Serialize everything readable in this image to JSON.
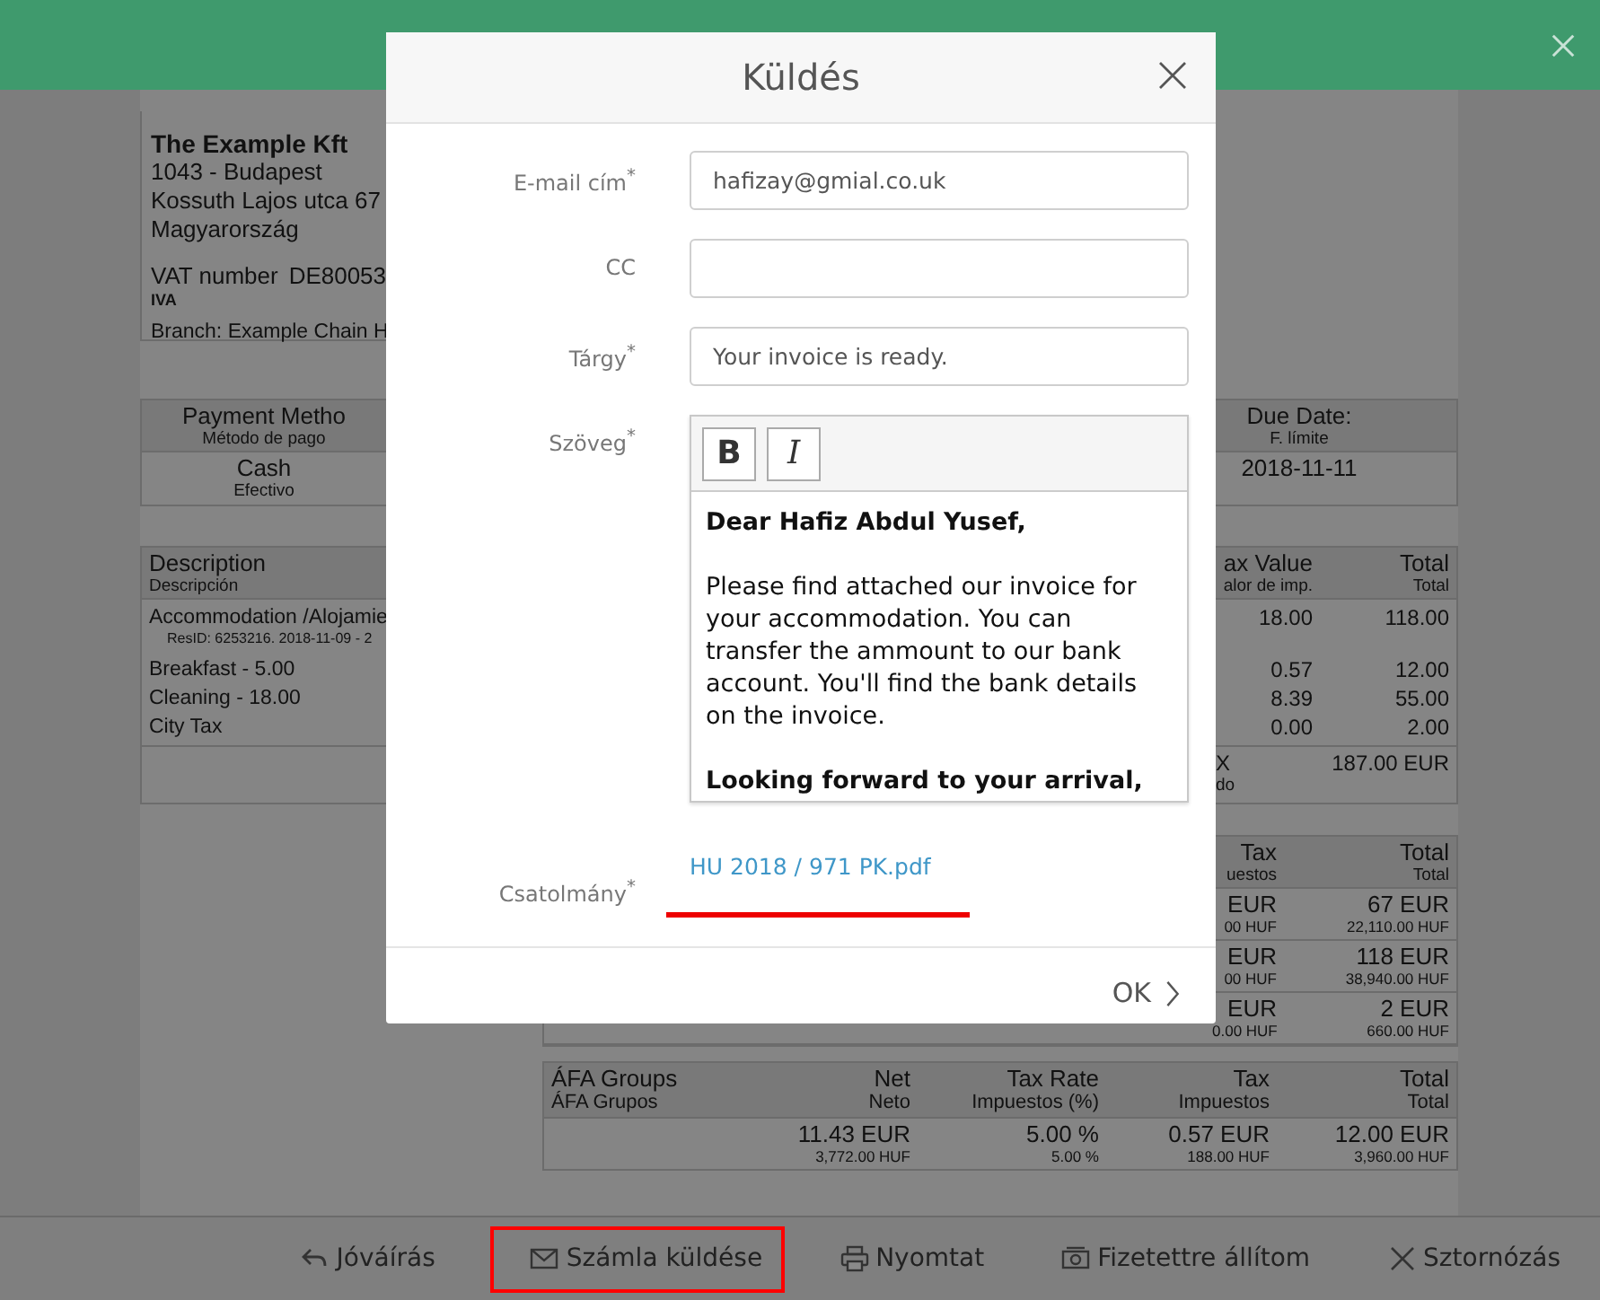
{
  "invoice": {
    "company": {
      "name": "The Example Kft",
      "lines": [
        "1043 - Budapest",
        "Kossuth Lajos utca 67",
        "Magyarország"
      ],
      "vat_label": "VAT number",
      "vat_value": "DE80053",
      "vat_sub": "IVA",
      "branch": "Branch: Example Chain H"
    },
    "payment": {
      "header": "Payment Metho",
      "sub": "Método de pago",
      "value": "Cash",
      "value_sub": "Efectivo"
    },
    "due": {
      "header": "Due Date:",
      "sub": "F. límite",
      "value": "2018-11-11"
    },
    "items": {
      "columns": [
        {
          "title": "Description",
          "sub": "Descripción"
        },
        {
          "title": "ax Value",
          "sub": "alor de imp."
        },
        {
          "title": "Total",
          "sub": "Total"
        }
      ],
      "rows": [
        {
          "description": "Accommodation /Alojamie",
          "note": "ResID: 6253216. 2018-11-09 - 2",
          "tax_value": "18.00",
          "total": "118.00"
        },
        {
          "description": "Breakfast - 5.00",
          "tax_value": "0.57",
          "total": "12.00"
        },
        {
          "description": "Cleaning - 18.00",
          "tax_value": "8.39",
          "total": "55.00"
        },
        {
          "description": "City Tax",
          "tax_value": "0.00",
          "total": "2.00"
        }
      ],
      "total_label": "X",
      "total_sub": "do",
      "total_value": "187.00 EUR"
    },
    "tax_summary": {
      "columns": [
        {
          "title": "Tax",
          "sub": "uestos"
        },
        {
          "title": "Total",
          "sub": "Total"
        }
      ],
      "rows": [
        {
          "tax": "EUR",
          "tax_sub": "00 HUF",
          "total": "67 EUR",
          "total_sub": "22,110.00 HUF"
        },
        {
          "tax": "EUR",
          "tax_sub": "00 HUF",
          "total": "118 EUR",
          "total_sub": "38,940.00 HUF"
        },
        {
          "tax": "EUR",
          "tax_sub": "0.00 HUF",
          "total": "2 EUR",
          "total_sub": "660.00 HUF"
        }
      ]
    },
    "vat_groups": {
      "columns": [
        {
          "title": "ÁFA Groups",
          "sub": "ÁFA Grupos"
        },
        {
          "title": "Net",
          "sub": "Neto"
        },
        {
          "title": "Tax Rate",
          "sub": "Impuestos (%)"
        },
        {
          "title": "Tax",
          "sub": "Impuestos"
        },
        {
          "title": "Total",
          "sub": "Total"
        }
      ],
      "rows": [
        {
          "net": "11.43 EUR",
          "net_huf": "3,772.00 HUF",
          "tax_rate": "5.00 %",
          "tax_rate_huf": "5.00 %",
          "tax": "0.57 EUR",
          "tax_huf": "188.00 HUF",
          "total": "12.00 EUR",
          "total_huf": "3,960.00 HUF"
        }
      ]
    }
  },
  "dialog": {
    "title": "Küldés",
    "fields": [
      {
        "kind": "input",
        "label": "E-mail cím$^{*}$",
        "value": "hafizay@gmial.co.uk"
      },
      {
        "kind": "input",
        "label": "CC"
      },
      {
        "kind": "input",
        "label": "Tárgy$^{*}$",
        "value": "Your invoice is ready."
      },
      {
        "kind": "editor",
        "label": "Szöveg$^{*}$",
        "format_buttons": [
          {
            "label": "B",
            "kind": "bold"
          },
          {
            "label": "I",
            "kind": "italic"
          }
        ],
        "paragraphs": [
          {
            "text": "Dear Hafiz Abdul Yusef,",
            "bold": true
          },
          {
            "text": "Please find attached our invoice for your accommodation. You can transfer the ammount to our bank account. You'll find the bank details on the invoice.",
            "bold": false
          },
          {
            "text": "Looking forward to your arrival,",
            "bold": true
          }
        ]
      },
      {
        "kind": "attachment",
        "label": "Csatolmány$^{*}$",
        "value": "HU 2018 / 971 PK.pdf",
        "highlighted": true
      }
    ],
    "ok": "OK"
  },
  "actions": [
    {
      "kind": "reply",
      "label": "Jóváírás",
      "highlighted": false
    },
    {
      "kind": "mail",
      "label": "Számla küldése",
      "highlighted": true
    },
    {
      "kind": "print",
      "label": "Nyomtat",
      "highlighted": false
    },
    {
      "kind": "money",
      "label": "Fizetettre állítom",
      "highlighted": false
    },
    {
      "kind": "cancel",
      "label": "Sztornózás",
      "highlighted": false
    }
  ]
}
